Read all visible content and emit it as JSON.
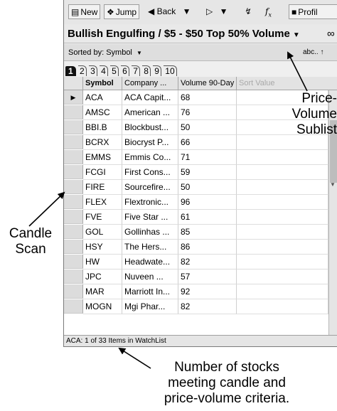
{
  "toolbar": {
    "new_label": "New",
    "jump_label": "Jump",
    "back_label": "Back",
    "profile_label": "Profil",
    "icons": [
      "new-doc-icon",
      "jump-icon",
      "back-arrow-icon",
      "forward-arrow-icon",
      "lightning-icon",
      "function-icon",
      "profile-icon"
    ]
  },
  "list": {
    "title": "Bullish Engulfing / $5 - $50 Top 50% Volume",
    "sorted_by": "Sorted by: Symbol",
    "sort_mode": "abc..",
    "tabs": [
      "1",
      "2",
      "3",
      "4",
      "5",
      "6",
      "7",
      "8",
      "9",
      "10"
    ],
    "active_tab": "1",
    "columns": [
      "Symbol",
      "Company ...",
      "Volume 90-Day",
      "Sort Value"
    ],
    "rows": [
      {
        "symbol": "ACA",
        "company": "ACA Capit...",
        "volume": "68",
        "selected": true
      },
      {
        "symbol": "AMSC",
        "company": "American ...",
        "volume": "76"
      },
      {
        "symbol": "BBI.B",
        "company": "Blockbust...",
        "volume": "50"
      },
      {
        "symbol": "BCRX",
        "company": "Biocryst P...",
        "volume": "66"
      },
      {
        "symbol": "EMMS",
        "company": "Emmis Co...",
        "volume": "71"
      },
      {
        "symbol": "FCGI",
        "company": "First Cons...",
        "volume": "59"
      },
      {
        "symbol": "FIRE",
        "company": "Sourcefire...",
        "volume": "50"
      },
      {
        "symbol": "FLEX",
        "company": "Flextronic...",
        "volume": "96"
      },
      {
        "symbol": "FVE",
        "company": "Five Star ...",
        "volume": "61"
      },
      {
        "symbol": "GOL",
        "company": "Gollinhas ...",
        "volume": "85"
      },
      {
        "symbol": "HSY",
        "company": "The Hers...",
        "volume": "86"
      },
      {
        "symbol": "HW",
        "company": "Headwate...",
        "volume": "82"
      },
      {
        "symbol": "JPC",
        "company": "Nuveen ...",
        "volume": "57"
      },
      {
        "symbol": "MAR",
        "company": "Marriott In...",
        "volume": "92"
      },
      {
        "symbol": "MOGN",
        "company": "Mgi Phar...",
        "volume": "82"
      }
    ],
    "status": "ACA: 1 of 33 Items in WatchList"
  },
  "annotations": {
    "candle_scan": [
      "Candle",
      "Scan"
    ],
    "price_volume": [
      "Price-",
      "Volume",
      "Sublist"
    ],
    "count_note": [
      "Number of stocks",
      "meeting candle and",
      "price-volume criteria."
    ]
  }
}
